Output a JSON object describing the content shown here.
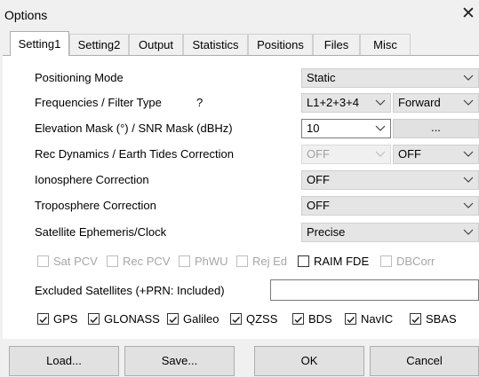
{
  "window": {
    "title": "Options",
    "close_glyph": "✕"
  },
  "tabs": [
    {
      "label": "Setting1",
      "active": true
    },
    {
      "label": "Setting2"
    },
    {
      "label": "Output"
    },
    {
      "label": "Statistics"
    },
    {
      "label": "Positions"
    },
    {
      "label": "Files"
    },
    {
      "label": "Misc"
    }
  ],
  "settings": {
    "positioning_mode": {
      "label": "Positioning Mode",
      "value": "Static"
    },
    "frequencies": {
      "label": "Frequencies / Filter Type",
      "help": "?",
      "freq_value": "L1+2+3+4",
      "filter_value": "Forward"
    },
    "elevation": {
      "label": "Elevation Mask (°) / SNR Mask (dBHz)",
      "value": "10",
      "snr_button": "..."
    },
    "rec_dynamics": {
      "label": "Rec Dynamics / Earth Tides Correction",
      "dynamics_value": "OFF",
      "tides_value": "OFF"
    },
    "ionosphere": {
      "label": "Ionosphere Correction",
      "value": "OFF"
    },
    "troposphere": {
      "label": "Troposphere Correction",
      "value": "OFF"
    },
    "ephemeris": {
      "label": "Satellite Ephemeris/Clock",
      "value": "Precise"
    }
  },
  "options_checks": [
    {
      "label": "Sat PCV",
      "checked": false,
      "enabled": false
    },
    {
      "label": "Rec PCV",
      "checked": false,
      "enabled": false
    },
    {
      "label": "PhWU",
      "checked": false,
      "enabled": false
    },
    {
      "label": "Rej Ed",
      "checked": false,
      "enabled": false
    },
    {
      "label": "RAIM FDE",
      "checked": false,
      "enabled": true
    },
    {
      "label": "DBCorr",
      "checked": false,
      "enabled": false
    }
  ],
  "excluded": {
    "label": "Excluded Satellites (+PRN: Included)",
    "value": ""
  },
  "constellations": [
    {
      "label": "GPS",
      "checked": true
    },
    {
      "label": "GLONASS",
      "checked": true
    },
    {
      "label": "Galileo",
      "checked": true
    },
    {
      "label": "QZSS",
      "checked": true
    },
    {
      "label": "BDS",
      "checked": true
    },
    {
      "label": "NavIC",
      "checked": true
    },
    {
      "label": "SBAS",
      "checked": true
    }
  ],
  "buttons": {
    "load": "Load...",
    "save": "Save...",
    "ok": "OK",
    "cancel": "Cancel"
  },
  "colors": {
    "accent": "#0078d7",
    "panel": "#ffffff",
    "chrome": "#f0f0f0"
  },
  "icons": {
    "dropdown": "chevron-down-icon",
    "checkmark": "checkmark-icon",
    "close": "close-icon"
  }
}
